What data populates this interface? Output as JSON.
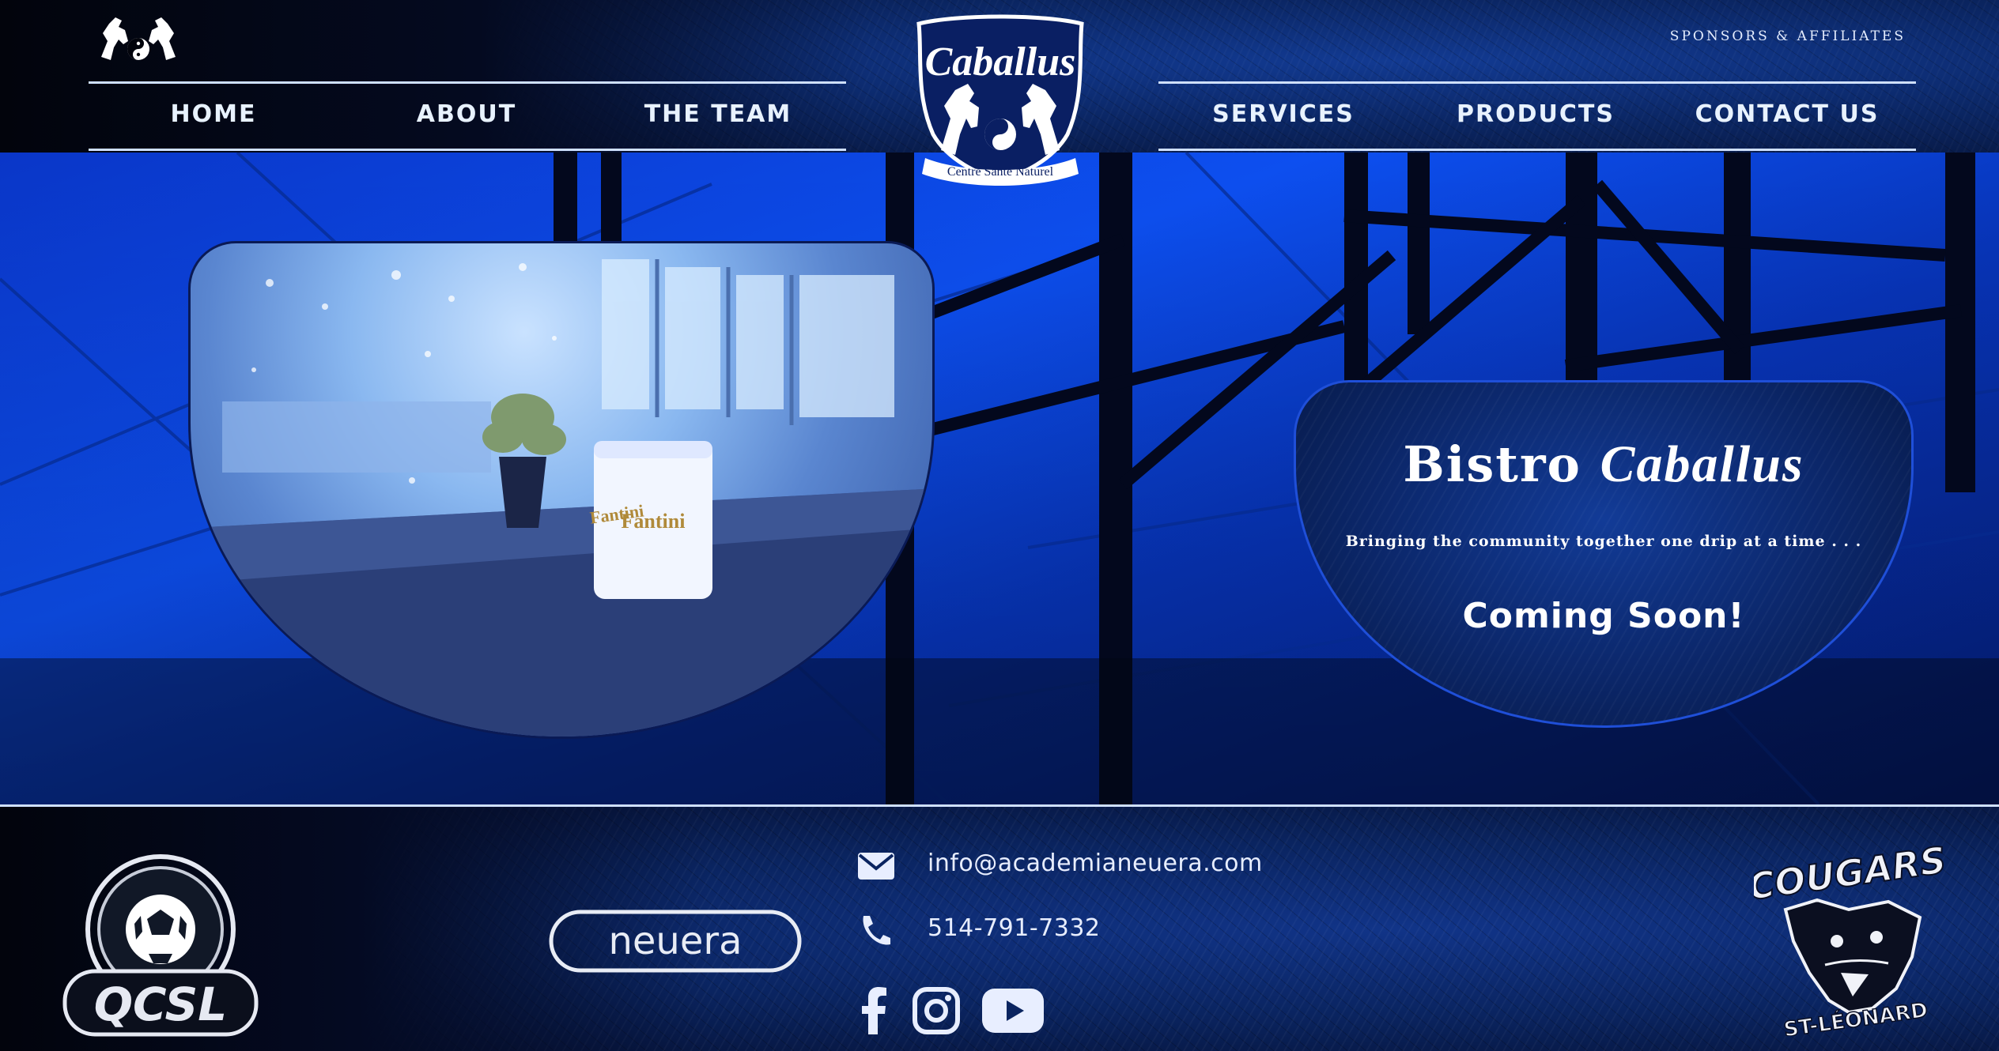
{
  "header": {
    "brand_name": "Caballus",
    "brand_subtitle": "Centre Sante Naturel",
    "sponsors_link": "SPONSORS & AFFILIATES",
    "nav_left": [
      "HOME",
      "ABOUT",
      "THE TEAM"
    ],
    "nav_right": [
      "SERVICES",
      "PRODUCTS",
      "CONTACT US"
    ]
  },
  "hero": {
    "photo_sign_text": "Fantini",
    "title_prefix": "Bistro",
    "title_script": "Caballus",
    "tagline": "Bringing the community together one drip at a time . . .",
    "status": "Coming Soon!"
  },
  "footer": {
    "email": "info@academianeuera.com",
    "phone": "514-791-7332",
    "left_logo_text": "QCSL",
    "center_logo_text": "neuera",
    "right_logo_top": "COUGARS",
    "right_logo_bottom": "ST-LÉONARD",
    "social_icons": [
      "facebook-icon",
      "instagram-icon",
      "youtube-icon"
    ]
  },
  "colors": {
    "accent_blue": "#0d4ff0",
    "dark_navy": "#050a1e",
    "text_white": "#ffffff",
    "line": "#cfe0ff"
  }
}
